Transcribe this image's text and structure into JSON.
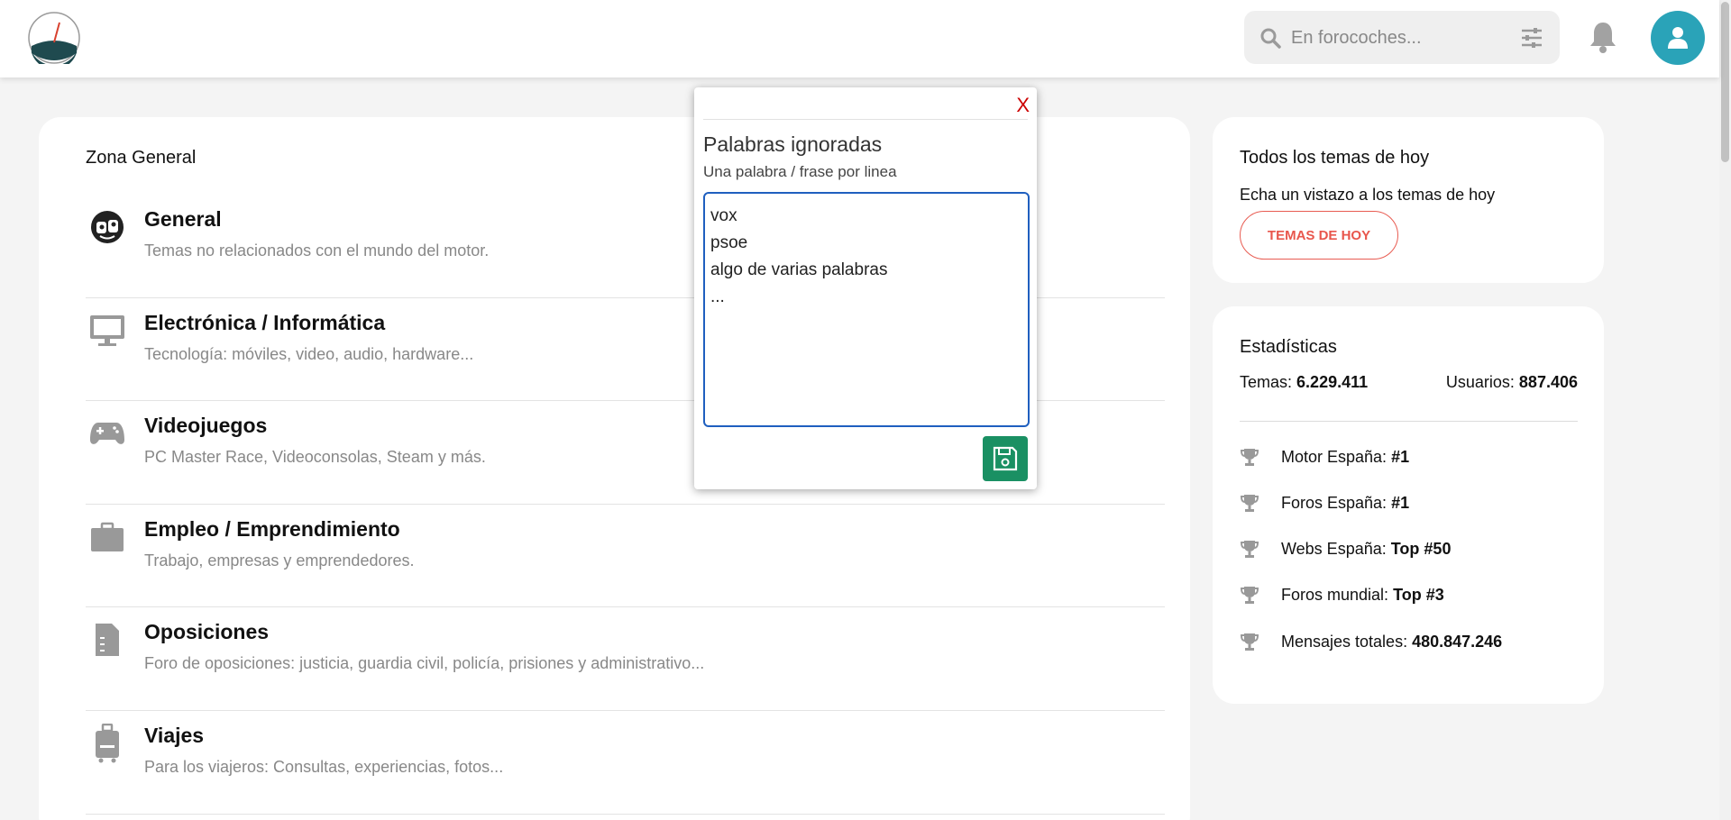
{
  "header": {
    "search_placeholder": "En forocoches..."
  },
  "main": {
    "zone_title": "Zona General",
    "forums": [
      {
        "title": "General",
        "desc": "Temas no relacionados con el mundo del motor.",
        "icon": "general-icon"
      },
      {
        "title": "Electrónica / Informática",
        "desc": "Tecnología: móviles, video, audio, hardware...",
        "icon": "monitor-icon"
      },
      {
        "title": "Videojuegos",
        "desc": "PC Master Race, Videoconsolas, Steam y más.",
        "icon": "gamepad-icon"
      },
      {
        "title": "Empleo / Emprendimiento",
        "desc": "Trabajo, empresas y emprendedores.",
        "icon": "briefcase-icon"
      },
      {
        "title": "Oposiciones",
        "desc": "Foro de oposiciones: justicia, guardia civil, policía, prisiones y administrativo...",
        "icon": "document-icon"
      },
      {
        "title": "Viajes",
        "desc": "Para los viajeros: Consultas, experiencias, fotos...",
        "icon": "luggage-icon"
      }
    ]
  },
  "today": {
    "title": "Todos los temas de hoy",
    "text": "Echa un vistazo a los temas de hoy",
    "button": "TEMAS DE HOY"
  },
  "stats": {
    "title": "Estadísticas",
    "temas_label": "Temas:",
    "temas_value": "6.229.411",
    "usuarios_label": "Usuarios:",
    "usuarios_value": "887.406",
    "ranks": [
      {
        "label": "Motor España:",
        "value": "#1"
      },
      {
        "label": "Foros España:",
        "value": "#1"
      },
      {
        "label": "Webs España:",
        "value": "Top #50"
      },
      {
        "label": "Foros mundial:",
        "value": "Top #3"
      },
      {
        "label": "Mensajes totales:",
        "value": "480.847.246"
      }
    ]
  },
  "popup": {
    "close": "X",
    "title": "Palabras ignoradas",
    "subtitle": "Una palabra / frase por linea",
    "textarea_value": "vox\npsoe\nalgo de varias palabras\n..."
  },
  "colors": {
    "accent": "#2aa3b8",
    "button_red": "#e8564c",
    "save_green": "#1a9063",
    "close_red": "#cc0000"
  }
}
